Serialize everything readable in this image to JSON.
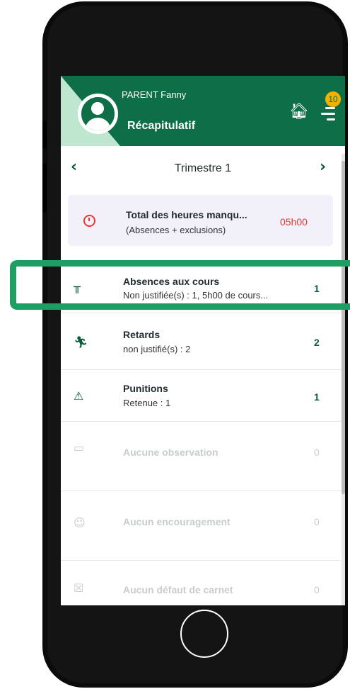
{
  "header": {
    "user_name": "PARENT Fanny",
    "page_title": "Récapitulatif",
    "notification_count": "10"
  },
  "term": {
    "prev_icon": "chevron-left",
    "next_icon": "chevron-right",
    "label": "Trimestre 1"
  },
  "total": {
    "title": "Total des heures manqu...",
    "subtitle": "(Absences + exclusions)",
    "value": "05h00"
  },
  "rows": [
    {
      "icon": "desk-icon",
      "title": "Absences aux cours",
      "subtitle": "Non justifiée(s) : 1, 5h00 de cours...",
      "count": "1"
    },
    {
      "icon": "running-icon",
      "title": "Retards",
      "subtitle": "non justifié(s) : 2",
      "count": "2"
    },
    {
      "icon": "warning-icon",
      "title": "Punitions",
      "subtitle": "Retenue : 1",
      "count": "1"
    },
    {
      "icon": "observation-icon",
      "title": "Aucune observation",
      "subtitle": "",
      "count": "0"
    },
    {
      "icon": "smiley-icon",
      "title": "Aucun encouragement",
      "subtitle": "",
      "count": "0"
    },
    {
      "icon": "notebook-icon",
      "title": "Aucun défaut de carnet",
      "subtitle": "",
      "count": "0"
    }
  ],
  "colors": {
    "brand_green": "#0d6e47",
    "light_green": "#bfe6cf",
    "highlight_green": "#1e9e62",
    "alert_red": "#e53935",
    "badge_yellow": "#f2b203"
  }
}
